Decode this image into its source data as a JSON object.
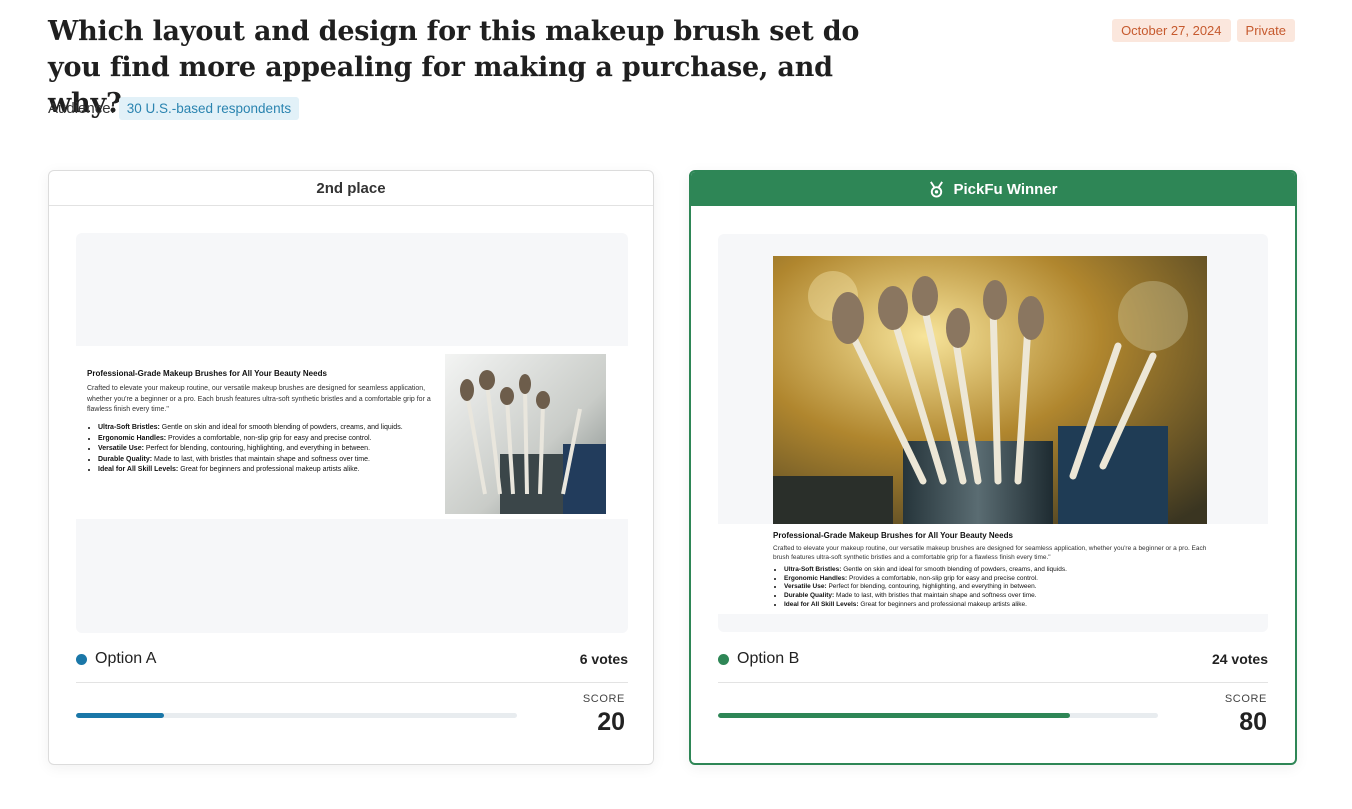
{
  "question": "Which layout and design for this makeup brush set do you find more appealing for making a purchase, and why?",
  "date": "October 27, 2024",
  "visibility": "Private",
  "audience_label": "Audience:",
  "audience_value": "30 U.S.-based respondents",
  "listing": {
    "title": "Professional-Grade Makeup Brushes for All Your Beauty Needs",
    "body": "Crafted to elevate your makeup routine, our versatile makeup brushes are designed for seamless application, whether you're a beginner or a pro. Each brush features ultra-soft synthetic bristles and a comfortable grip for a flawless finish every time.\"",
    "bullets": [
      {
        "k": "Ultra-Soft Bristles:",
        "v": "Gentle on skin and ideal for smooth blending of powders, creams, and liquids."
      },
      {
        "k": "Ergonomic Handles:",
        "v": "Provides a comfortable, non-slip grip for easy and precise control."
      },
      {
        "k": "Versatile Use:",
        "v": "Perfect for blending, contouring, highlighting, and everything in between."
      },
      {
        "k": "Durable Quality:",
        "v": "Made to last, with bristles that maintain shape and softness over time."
      },
      {
        "k": "Ideal for All Skill Levels:",
        "v": "Great for beginners and professional makeup artists alike."
      }
    ]
  },
  "options": [
    {
      "place": "2nd place",
      "name": "Option A",
      "votes": "6 votes",
      "score_label": "SCORE",
      "score": "20",
      "score_fraction": 0.2,
      "color": "#1a77a8"
    },
    {
      "place": "PickFu Winner",
      "name": "Option B",
      "votes": "24 votes",
      "score_label": "SCORE",
      "score": "80",
      "score_fraction": 0.8,
      "color": "#2e8656"
    }
  ]
}
